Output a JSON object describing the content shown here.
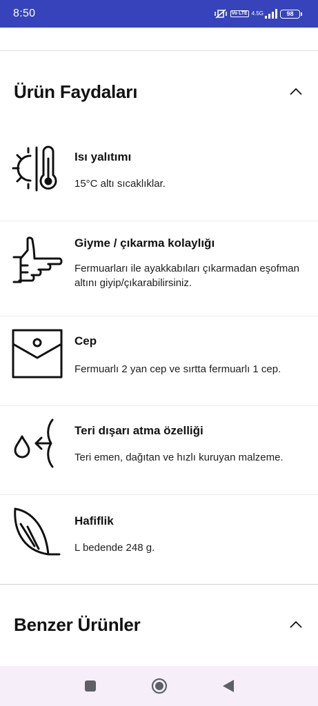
{
  "status_bar": {
    "time": "8:50",
    "lte_label": "Vo LTE",
    "network": "4.5G",
    "battery": "98"
  },
  "sections": {
    "benefits_title": "Ürün Faydaları",
    "similar_title": "Benzer Ürünler"
  },
  "benefits": [
    {
      "title": "Isı yalıtımı",
      "description": "15°C altı sıcaklıklar.",
      "icon": "thermometer-icon"
    },
    {
      "title": "Giyme / çıkarma kolaylığı",
      "description": "Fermuarları ile ayakkabıları çıkarmadan eşofman altını giyip/çıkarabilirsiniz.",
      "icon": "thumbs-up-icon"
    },
    {
      "title": "Cep",
      "description": "Fermuarlı 2 yan cep ve sırtta fermuarlı 1 cep.",
      "icon": "pocket-icon"
    },
    {
      "title": "Teri dışarı atma özelliği",
      "description": "Teri emen, dağıtan ve hızlı kuruyan malzeme.",
      "icon": "moisture-wicking-icon"
    },
    {
      "title": "Hafiflik",
      "description": "L bedende 248 g.",
      "icon": "feather-icon"
    }
  ],
  "navigation": {
    "icons": [
      "recent-apps-icon",
      "home-icon",
      "back-icon"
    ]
  }
}
